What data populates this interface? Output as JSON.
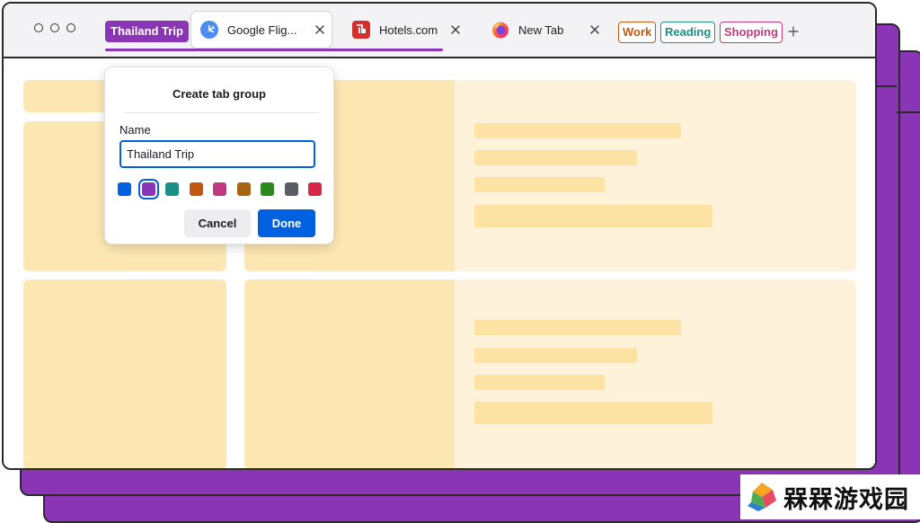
{
  "window": {
    "tab_groups": {
      "active_group_label": "Thailand Trip",
      "active_group_color": "#8a35b5"
    },
    "tabs": [
      {
        "title": "Google Flig...",
        "favicon": "airplane-icon",
        "active": true
      },
      {
        "title": "Hotels.com",
        "favicon": "hotels-icon",
        "active": false
      },
      {
        "title": "New Tab",
        "favicon": "firefox-icon",
        "active": false
      }
    ],
    "collapsed_groups": [
      {
        "label": "Work",
        "color": "#c05a12"
      },
      {
        "label": "Reading",
        "color": "#1c8f87"
      },
      {
        "label": "Shopping",
        "color": "#c13a80"
      }
    ],
    "new_tab_icon": "plus-icon"
  },
  "dialog": {
    "title": "Create tab group",
    "name_label": "Name",
    "name_value": "Thailand Trip",
    "colors": [
      "#0061e0",
      "#8a35b5",
      "#1c8f87",
      "#c05a12",
      "#c13a80",
      "#a86412",
      "#2d8a1e",
      "#5b5b66",
      "#d7264a"
    ],
    "selected_color_index": 1,
    "cancel_label": "Cancel",
    "done_label": "Done"
  },
  "watermark": {
    "text": "槑槑游戏园"
  }
}
